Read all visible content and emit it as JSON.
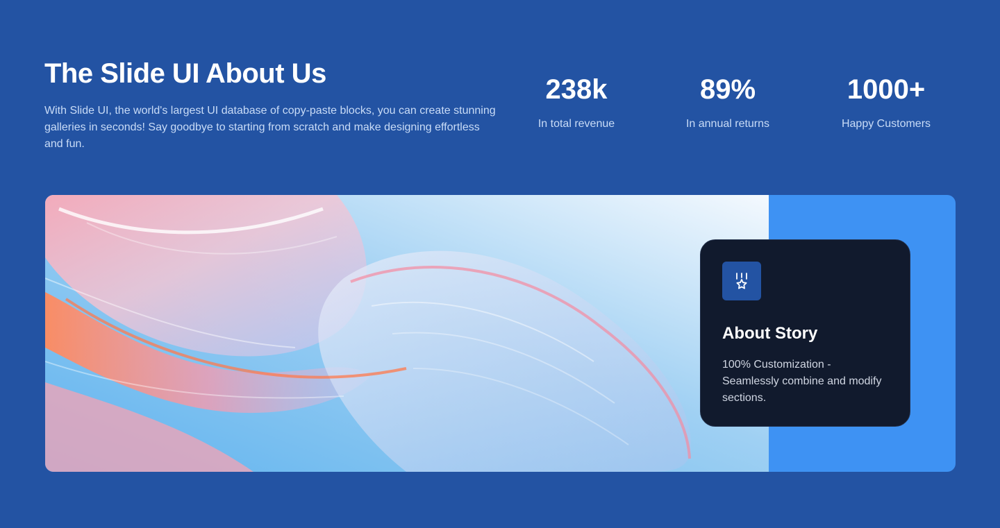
{
  "header": {
    "title": "The Slide UI About Us",
    "description": "With Slide UI, the world's largest UI database of copy-paste blocks, you can create stunning galleries in seconds! Say goodbye to starting from scratch and make designing effortless and fun."
  },
  "stats": [
    {
      "value": "238k",
      "label": "In total revenue"
    },
    {
      "value": "89%",
      "label": "In annual returns"
    },
    {
      "value": "1000+",
      "label": "Happy Customers"
    }
  ],
  "story": {
    "icon": "medal-star-icon",
    "title": "About Story",
    "text": "100% Customization - Seamlessly combine and modify sections."
  },
  "colors": {
    "background": "#2353a3",
    "accent_panel": "#3e92f3",
    "card": "#111a2d",
    "badge": "#2353a3"
  }
}
